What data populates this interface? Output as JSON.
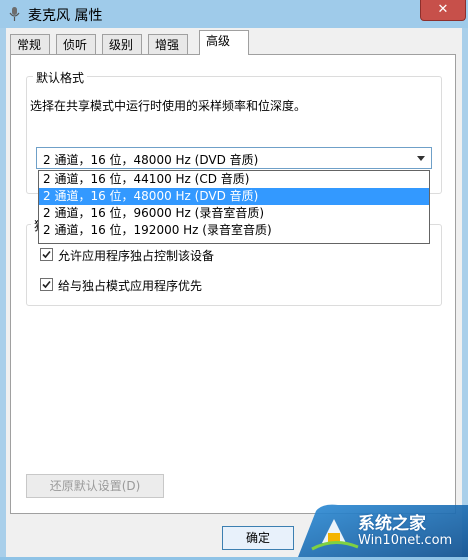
{
  "window": {
    "title": "麦克风 属性",
    "close_glyph": "✕"
  },
  "tabs": [
    {
      "label": "常规"
    },
    {
      "label": "侦听"
    },
    {
      "label": "级别"
    },
    {
      "label": "增强"
    },
    {
      "label": "高级"
    }
  ],
  "default_format": {
    "group_label": "默认格式",
    "description": "选择在共享模式中运行时使用的采样频率和位深度。",
    "selected": "2 通道，16 位，48000 Hz (DVD 音质)",
    "options": [
      "2 通道，16 位，44100 Hz (CD 音质)",
      "2 通道，16 位，48000 Hz (DVD 音质)",
      "2 通道，16 位，96000 Hz (录音室音质)",
      "2 通道，16 位，192000 Hz (录音室音质)"
    ]
  },
  "exclusive_mode": {
    "group_label": "独",
    "allow_label": "允许应用程序独占控制该设备",
    "allow_checked": true,
    "priority_label": "给与独占模式应用程序优先",
    "priority_checked": true
  },
  "buttons": {
    "restore_defaults": "还原默认设置(D)",
    "ok": "确定"
  },
  "watermark": {
    "line1": "系统之家",
    "line2": "Win10net.com"
  }
}
